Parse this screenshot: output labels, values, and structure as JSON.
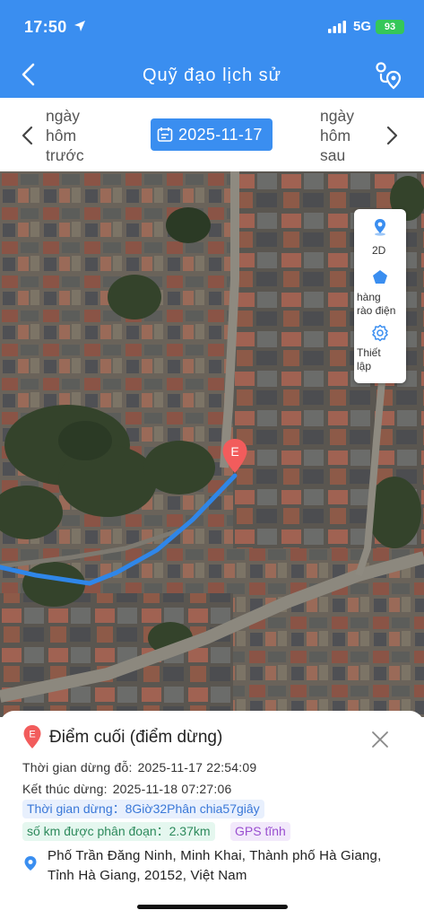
{
  "status_bar": {
    "time": "17:50",
    "network": "5G",
    "battery": "93"
  },
  "nav": {
    "title": "Quỹ đạo lịch sử",
    "icons": [
      "back-icon",
      "route-history-icon"
    ]
  },
  "date_bar": {
    "prev_label": "ngày\nhôm\ntrước",
    "next_label": "ngày\nhôm\nsau",
    "date": "2025-11-17"
  },
  "map_tools": {
    "mode_2d": "2D",
    "fence": "hàng\nrào điện",
    "settings": "Thiết\nlập"
  },
  "marker": {
    "letter": "E"
  },
  "detail": {
    "marker_letter": "E",
    "title": "Điểm cuối (điểm dừng)",
    "stop_label": "Thời gian dừng đỗ:",
    "stop_value": "2025-11-17 22:54:09",
    "end_label": "Kết thúc dừng:",
    "end_value": "2025-11-18 07:27:06",
    "duration": "Thời gian dừng：8Giờ32Phân chia57giây",
    "km": "số km được phân đoạn：2.37km",
    "gps": "GPS tĩnh",
    "address": "Phố Trần Đăng Ninh, Minh Khai, Thành phố Hà Giang, Tỉnh Hà Giang, 20152, Việt Nam"
  },
  "colors": {
    "primary": "#3a8ef0",
    "route": "#2f86e8",
    "marker": "#f25c5c",
    "battery": "#35c759"
  }
}
